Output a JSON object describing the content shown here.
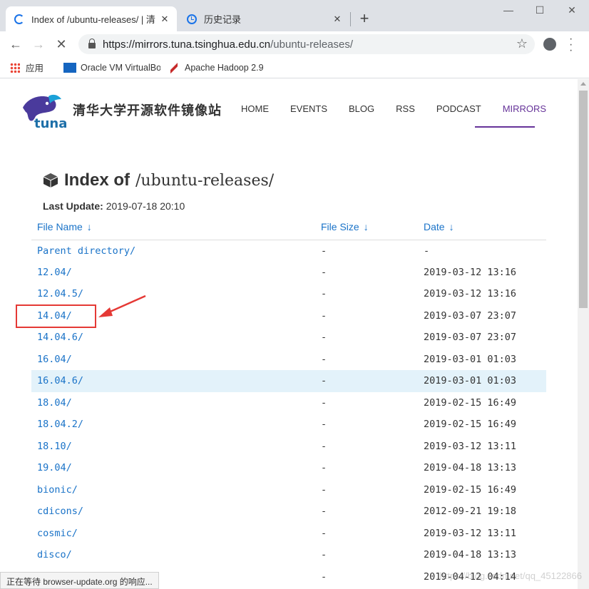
{
  "browser": {
    "tabs": [
      {
        "title": "Index of /ubuntu-releases/ | 清",
        "icon": "loading-spinner-icon"
      },
      {
        "title": "历史记录",
        "icon": "history-icon"
      }
    ],
    "url": {
      "host": "https://mirrors.tuna.tsinghua.edu.cn",
      "path": "/ubuntu-releases/"
    },
    "bookmarks": [
      "应用",
      "Oracle VM VirtualBo",
      "Apache Hadoop 2.9"
    ],
    "status": "正在等待 browser-update.org 的响应..."
  },
  "site": {
    "name": "清华大学开源软件镜像站",
    "logo_text": "tuna",
    "nav": [
      "HOME",
      "EVENTS",
      "BLOG",
      "RSS",
      "PODCAST",
      "MIRRORS"
    ],
    "active_nav": "MIRRORS",
    "accent_color": "#663399"
  },
  "index": {
    "heading_bold": "Index of",
    "path": "/ubuntu-releases/",
    "last_update_label": "Last Update:",
    "last_update_value": "2019-07-18 20:10",
    "columns": {
      "name": "File Name",
      "size": "File Size",
      "date": "Date",
      "sort_arrow": "↓"
    },
    "rows": [
      {
        "name": "Parent directory/",
        "size": "-",
        "date": "-"
      },
      {
        "name": "12.04/",
        "size": "-",
        "date": "2019-03-12 13:16"
      },
      {
        "name": "12.04.5/",
        "size": "-",
        "date": "2019-03-12 13:16"
      },
      {
        "name": "14.04/",
        "size": "-",
        "date": "2019-03-07 23:07"
      },
      {
        "name": "14.04.6/",
        "size": "-",
        "date": "2019-03-07 23:07"
      },
      {
        "name": "16.04/",
        "size": "-",
        "date": "2019-03-01 01:03"
      },
      {
        "name": "16.04.6/",
        "size": "-",
        "date": "2019-03-01 01:03"
      },
      {
        "name": "18.04/",
        "size": "-",
        "date": "2019-02-15 16:49"
      },
      {
        "name": "18.04.2/",
        "size": "-",
        "date": "2019-02-15 16:49"
      },
      {
        "name": "18.10/",
        "size": "-",
        "date": "2019-03-12 13:11"
      },
      {
        "name": "19.04/",
        "size": "-",
        "date": "2019-04-18 13:13"
      },
      {
        "name": "bionic/",
        "size": "-",
        "date": "2019-02-15 16:49"
      },
      {
        "name": "cdicons/",
        "size": "-",
        "date": "2012-09-21 19:18"
      },
      {
        "name": "cosmic/",
        "size": "-",
        "date": "2019-03-12 13:11"
      },
      {
        "name": "disco/",
        "size": "-",
        "date": "2019-04-18 13:13"
      },
      {
        "name": "",
        "size": "-",
        "date": "2019-04-12 04:14"
      }
    ],
    "hovered_row": "16.04.6/",
    "annotated_row": "14.04/"
  },
  "watermark": "https://blog.csdn.net/qq_45122866"
}
